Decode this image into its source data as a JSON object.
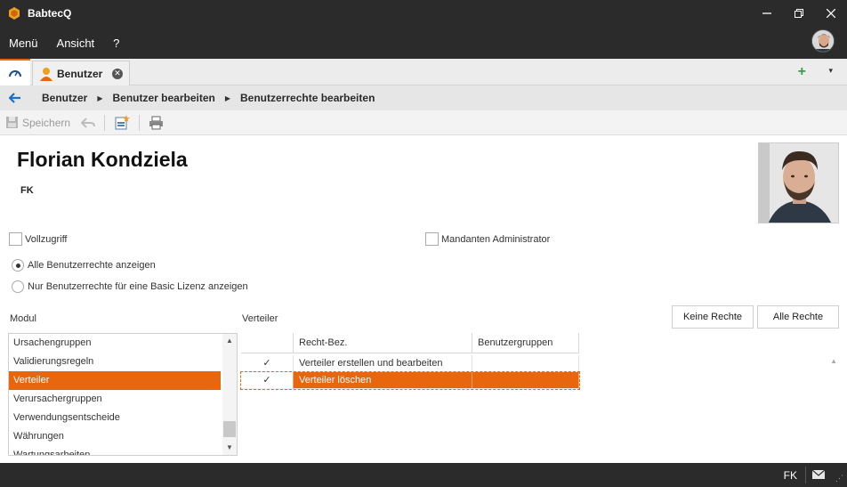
{
  "window": {
    "title": "BabtecQ"
  },
  "menu": {
    "items": [
      "Menü",
      "Ansicht",
      "?"
    ]
  },
  "tabs": {
    "active_label": "Benutzer",
    "add": "+",
    "more": "▾"
  },
  "breadcrumb": [
    "Benutzer",
    "Benutzer bearbeiten",
    "Benutzerrechte bearbeiten"
  ],
  "toolbar": {
    "save_label": "Speichern"
  },
  "user": {
    "name": "Florian Kondziela",
    "initials": "FK"
  },
  "options": {
    "full_access": "Vollzugriff",
    "tenant_admin": "Mandanten Administrator",
    "radio_all": "Alle Benutzerrechte anzeigen",
    "radio_basic": "Nur Benutzerrechte für eine Basic Lizenz anzeigen"
  },
  "module": {
    "label": "Modul",
    "items": [
      "Ursachengruppen",
      "Validierungsregeln",
      "Verteiler",
      "Verursachergruppen",
      "Verwendungsentscheide",
      "Währungen",
      "Wartungsarbeiten"
    ],
    "selected_index": 2
  },
  "verteiler": {
    "label": "Verteiler",
    "buttons": {
      "none": "Keine Rechte",
      "all": "Alle Rechte"
    },
    "columns": [
      "Recht-Bez.",
      "Benutzergruppen"
    ],
    "rows": [
      {
        "checked": "✓",
        "name": "Verteiler erstellen und bearbeiten",
        "groups": ""
      },
      {
        "checked": "✓",
        "name": "Verteiler löschen",
        "groups": ""
      }
    ],
    "selected_row": 1
  },
  "status": {
    "initials": "FK"
  },
  "colors": {
    "accent": "#e8660d",
    "chrome": "#2b2b2b"
  }
}
